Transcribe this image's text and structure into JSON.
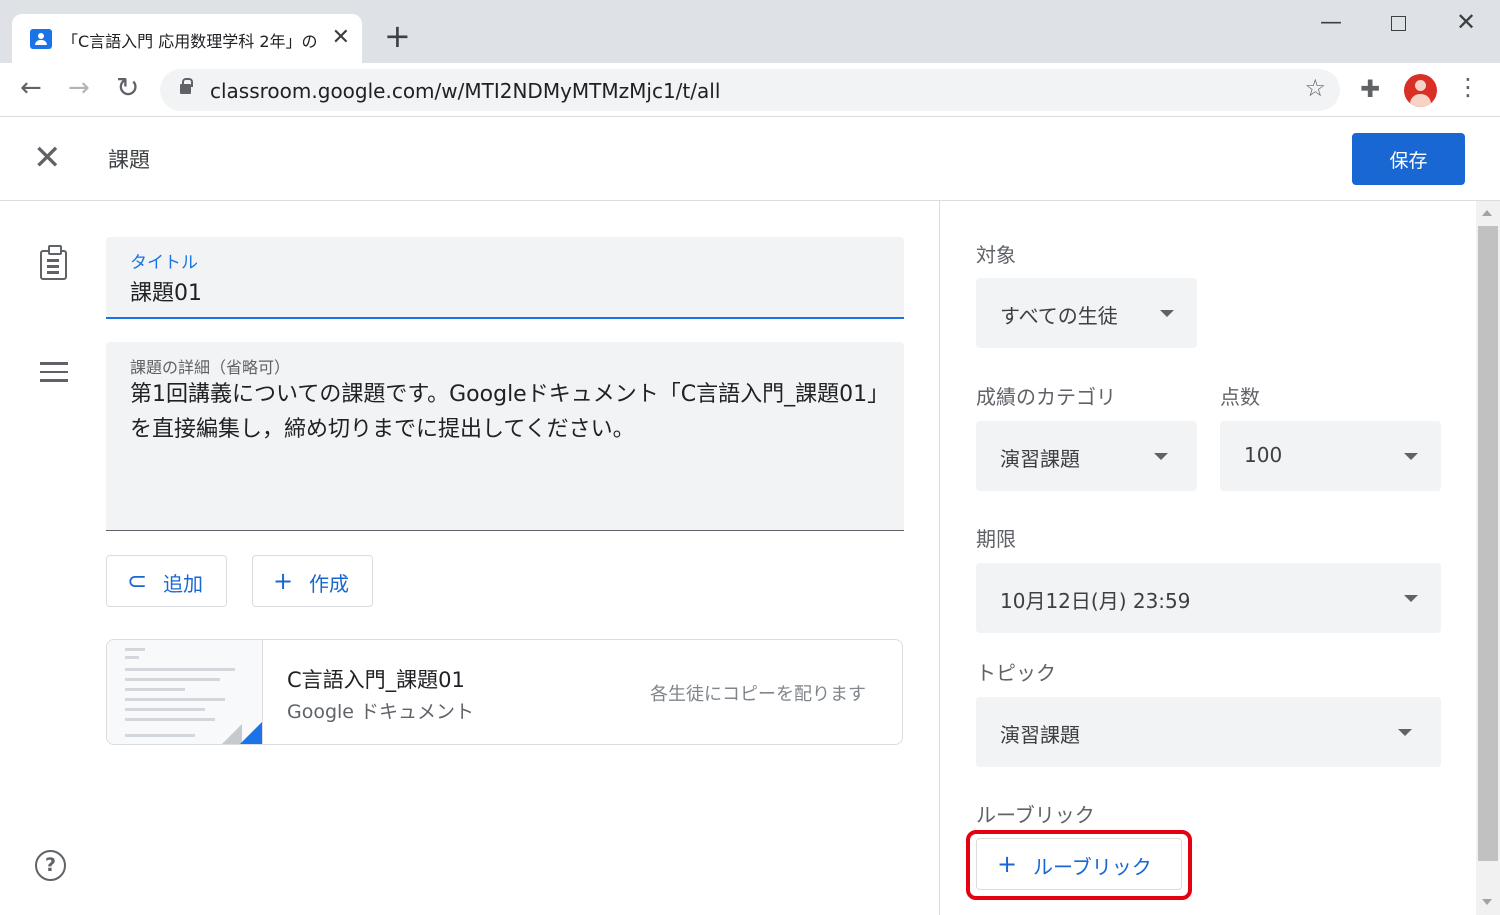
{
  "browser": {
    "tab_title": "「C言語入門 応用数理学科 2年」の",
    "tab_close": "✕",
    "new_tab": "+",
    "url": "classroom.google.com/w/MTI2NDMyMTMzMjc1/t/all",
    "icons": [
      "back-icon",
      "forward-icon",
      "reload-icon",
      "lock-icon",
      "star-icon",
      "extensions-icon",
      "profile-avatar",
      "menu-icon"
    ]
  },
  "header": {
    "title": "課題",
    "save_label": "保存"
  },
  "form": {
    "title_label": "タイトル",
    "title_value": "課題01",
    "details_label": "課題の詳細（省略可）",
    "details_value": "第1回講義についての課題です。Googleドキュメント「C言語入門_課題01」を直接編集し，締め切りまでに提出してください。",
    "add_label": "追加",
    "create_label": "作成",
    "attachment": {
      "title": "C言語入門_課題01",
      "type": "Google ドキュメント",
      "mode": "各生徒にコピーを配ります"
    }
  },
  "settings": {
    "target_label": "対象",
    "target_value": "すべての生徒",
    "category_label": "成績のカテゴリ",
    "category_value": "演習課題",
    "points_label": "点数",
    "points_value": "100",
    "due_label": "期限",
    "due_value": "10月12日(月) 23:59",
    "topic_label": "トピック",
    "topic_value": "演習課題",
    "rubric_label": "ルーブリック",
    "rubric_button": "ルーブリック"
  },
  "colors": {
    "accent": "#1967d2",
    "highlight": "#e50012",
    "field_bg": "#f1f3f4"
  }
}
